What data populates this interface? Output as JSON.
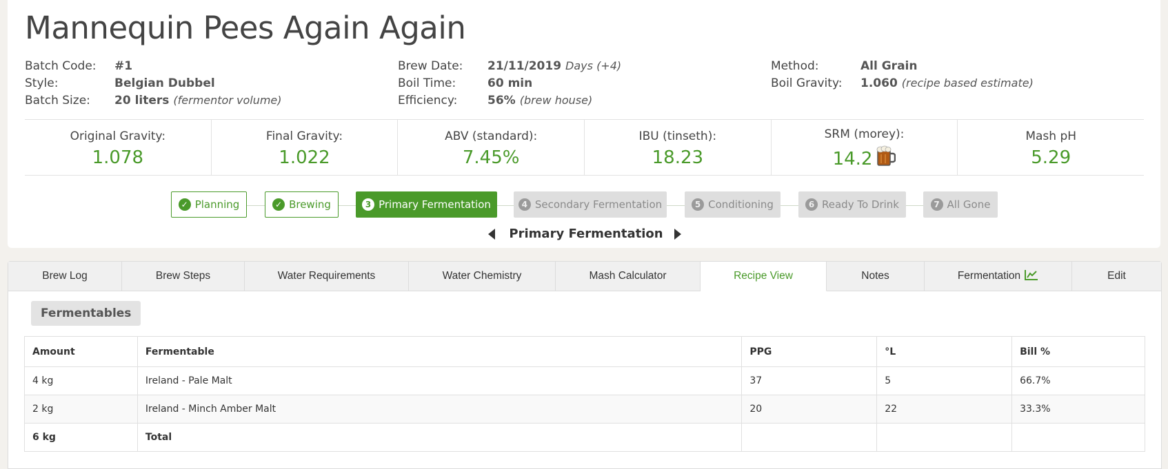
{
  "recipe": {
    "title": "Mannequin Pees Again Again"
  },
  "info": {
    "col1": [
      {
        "label": "Batch Code:",
        "value": "#1",
        "note": ""
      },
      {
        "label": "Style:",
        "value": "Belgian Dubbel",
        "note": ""
      },
      {
        "label": "Batch Size:",
        "value": "20 liters",
        "note": "(fermentor volume)"
      }
    ],
    "col2": [
      {
        "label": "Brew Date:",
        "value": "21/11/2019",
        "note": "Days (+4)"
      },
      {
        "label": "Boil Time:",
        "value": "60 min",
        "note": ""
      },
      {
        "label": "Efficiency:",
        "value": "56%",
        "note": "(brew house)"
      }
    ],
    "col3": [
      {
        "label": "Method:",
        "value": "All Grain",
        "note": ""
      },
      {
        "label": "Boil Gravity:",
        "value": "1.060",
        "note": "(recipe based estimate)"
      }
    ]
  },
  "stats": [
    {
      "label": "Original Gravity:",
      "value": "1.078"
    },
    {
      "label": "Final Gravity:",
      "value": "1.022"
    },
    {
      "label": "ABV (standard):",
      "value": "7.45%"
    },
    {
      "label": "IBU (tinseth):",
      "value": "18.23"
    },
    {
      "label": "SRM (morey):",
      "value": "14.2",
      "icon": "beer-mug-icon",
      "color": "#b05a14"
    },
    {
      "label": "Mash pH",
      "value": "5.29"
    }
  ],
  "stages": [
    {
      "num": "✓",
      "label": "Planning",
      "state": "done"
    },
    {
      "num": "✓",
      "label": "Brewing",
      "state": "done"
    },
    {
      "num": "3",
      "label": "Primary Fermentation",
      "state": "active"
    },
    {
      "num": "4",
      "label": "Secondary Fermentation",
      "state": "pending"
    },
    {
      "num": "5",
      "label": "Conditioning",
      "state": "pending"
    },
    {
      "num": "6",
      "label": "Ready To Drink",
      "state": "pending"
    },
    {
      "num": "7",
      "label": "All Gone",
      "state": "pending"
    }
  ],
  "current_stage": "Primary Fermentation",
  "tabs": [
    {
      "label": "Brew Log"
    },
    {
      "label": "Brew Steps"
    },
    {
      "label": "Water Requirements"
    },
    {
      "label": "Water Chemistry"
    },
    {
      "label": "Mash Calculator"
    },
    {
      "label": "Recipe View",
      "active": true
    },
    {
      "label": "Notes"
    },
    {
      "label": "Fermentation",
      "icon": "line-chart-icon"
    },
    {
      "label": "Edit"
    }
  ],
  "fermentables": {
    "section_title": "Fermentables",
    "headers": [
      "Amount",
      "Fermentable",
      "PPG",
      "°L",
      "Bill %"
    ],
    "rows": [
      [
        "4 kg",
        "Ireland - Pale Malt",
        "37",
        "5",
        "66.7%"
      ],
      [
        "2 kg",
        "Ireland - Minch Amber Malt",
        "20",
        "22",
        "33.3%"
      ]
    ],
    "total": [
      "6 kg",
      "Total",
      "",
      "",
      ""
    ]
  },
  "colors": {
    "accent": "#4a9a2a",
    "pending": "#dedede"
  }
}
